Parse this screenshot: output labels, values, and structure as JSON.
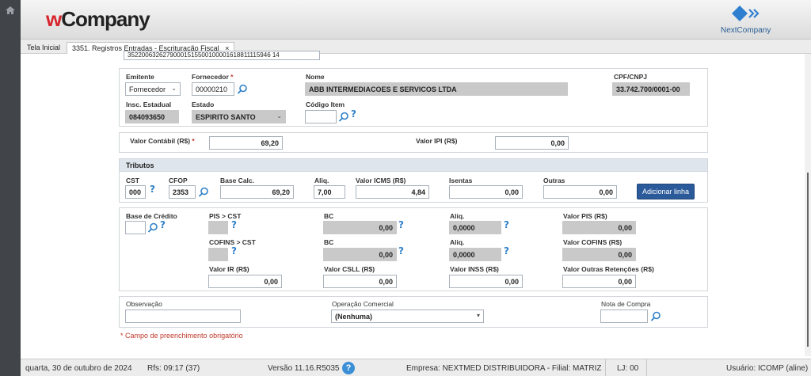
{
  "app": {
    "logo_w": "w",
    "logo_rest": "Company",
    "partner_logo_text": "NextCompany"
  },
  "tabs": [
    {
      "label": "Tela Inicial"
    },
    {
      "label": "3351. Registros Entradas - Escrituração Fiscal",
      "close": "×"
    }
  ],
  "form": {
    "access_key_fragment": "35220063262790001515500100001618811115946 14",
    "emitente": {
      "label": "Emitente",
      "value": "Fornecedor"
    },
    "fornecedor": {
      "label": "Fornecedor",
      "required_mark": "*",
      "value": "00000210"
    },
    "nome": {
      "label": "Nome",
      "value": "ABB INTERMEDIACOES E SERVICOS LTDA"
    },
    "cpf_cnpj": {
      "label": "CPF/CNPJ",
      "value": "33.742.700/0001-00"
    },
    "insc_estadual": {
      "label": "Insc. Estadual",
      "value": "084093650"
    },
    "estado": {
      "label": "Estado",
      "value": "ESPIRITO SANTO"
    },
    "codigo_item": {
      "label": "Código Item",
      "value": ""
    },
    "valor_contabil": {
      "label": "Valor Contábil (R$)",
      "required_mark": "*",
      "value": "69,20"
    },
    "valor_ipi": {
      "label": "Valor IPI (R$)",
      "value": "0,00"
    },
    "tributos": {
      "title": "Tributos",
      "cst": {
        "label": "CST",
        "value": "000"
      },
      "cfop": {
        "label": "CFOP",
        "value": "2353"
      },
      "base_calc": {
        "label": "Base Calc.",
        "value": "69,20"
      },
      "aliq": {
        "label": "Aliq.",
        "value": "7,00"
      },
      "valor_icms": {
        "label": "Valor ICMS (R$)",
        "value": "4,84"
      },
      "isentas": {
        "label": "Isentas",
        "value": "0,00"
      },
      "outras": {
        "label": "Outras",
        "value": "0,00"
      },
      "add_button": "Adicionar linha"
    },
    "credito": {
      "base_credito": {
        "label": "Base de Crédito",
        "value": ""
      },
      "pis_cst": {
        "label": "PIS > CST",
        "value": ""
      },
      "pis_bc": {
        "label": "BC",
        "value": "0,00"
      },
      "pis_aliq": {
        "label": "Aliq.",
        "value": "0,0000"
      },
      "valor_pis": {
        "label": "Valor PIS (R$)",
        "value": "0,00"
      },
      "cofins_cst": {
        "label": "COFINS > CST",
        "value": ""
      },
      "cofins_bc": {
        "label": "BC",
        "value": "0,00"
      },
      "cofins_aliq": {
        "label": "Aliq.",
        "value": "0,0000"
      },
      "valor_cofins": {
        "label": "Valor COFINS (R$)",
        "value": "0,00"
      },
      "valor_ir": {
        "label": "Valor IR (R$)",
        "value": "0,00"
      },
      "valor_csll": {
        "label": "Valor CSLL (R$)",
        "value": "0,00"
      },
      "valor_inss": {
        "label": "Valor INSS (R$)",
        "value": "0,00"
      },
      "valor_outras_ret": {
        "label": "Valor Outras Retenções (R$)",
        "value": "0,00"
      }
    },
    "observacao": {
      "label": "Observação",
      "value": ""
    },
    "operacao_comercial": {
      "label": "Operação Comercial",
      "value": "(Nenhuma)"
    },
    "nota_compra": {
      "label": "Nota de Compra",
      "value": ""
    },
    "required_note": "* Campo de preenchimento obrigatório"
  },
  "footer": {
    "date": "quarta, 30 de outubro de 2024",
    "rfs": "Rfs: 09:17 (37)",
    "version": "Versão 11.16.R5035",
    "help": "?",
    "empresa": "Empresa: NEXTMED DISTRIBUIDORA - Filial: MATRIZ",
    "lj": "LJ: 00",
    "usuario": "Usuário: ICOMP (aline)"
  },
  "colors": {
    "brand_red": "#d6262d",
    "primary_button": "#2b5a9a",
    "help_blue": "#2f80c9",
    "readonly_gray": "#c9c9c9"
  },
  "icons": [
    "home-icon",
    "search-icon",
    "help-icon",
    "chevron-down-icon",
    "close-icon",
    "nextcompany-logo-icon"
  ]
}
